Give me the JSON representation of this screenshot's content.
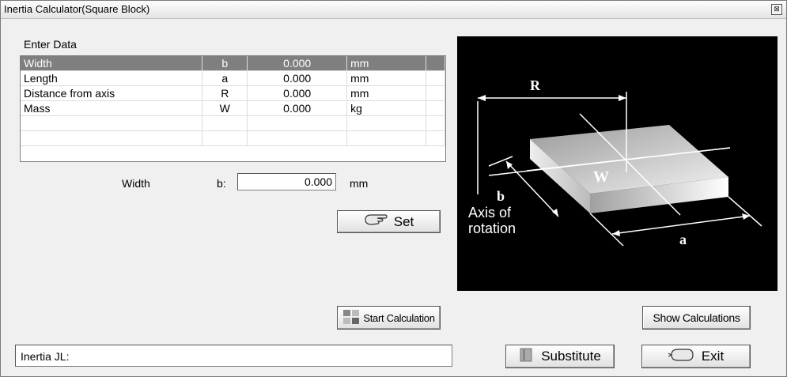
{
  "window": {
    "title": "Inertia Calculator(Square Block)",
    "close_label": "⊠"
  },
  "enter_data": {
    "label": "Enter Data",
    "rows": [
      {
        "name": "Width",
        "symbol": "b",
        "value": "0.000",
        "unit": "mm",
        "selected": true
      },
      {
        "name": "Length",
        "symbol": "a",
        "value": "0.000",
        "unit": "mm"
      },
      {
        "name": "Distance from axis",
        "symbol": "R",
        "value": "0.000",
        "unit": "mm"
      },
      {
        "name": "Mass",
        "symbol": "W",
        "value": "0.000",
        "unit": "kg"
      }
    ]
  },
  "editor": {
    "field_name": "Width",
    "symbol": "b:",
    "value": "0.000",
    "unit": "mm"
  },
  "buttons": {
    "set": "Set",
    "start_calculation": "Start Calculation",
    "show_calculations": "Show Calculations",
    "substitute": "Substitute",
    "exit": "Exit"
  },
  "result": {
    "label": "Inertia JL:",
    "value": ""
  },
  "figure": {
    "R": "R",
    "W": "W",
    "b": "b",
    "a": "a",
    "axis_line1": "Axis of",
    "axis_line2": "rotation"
  },
  "colors": {
    "selected_row": "#7f7f7f",
    "panel_bg": "#000000"
  }
}
